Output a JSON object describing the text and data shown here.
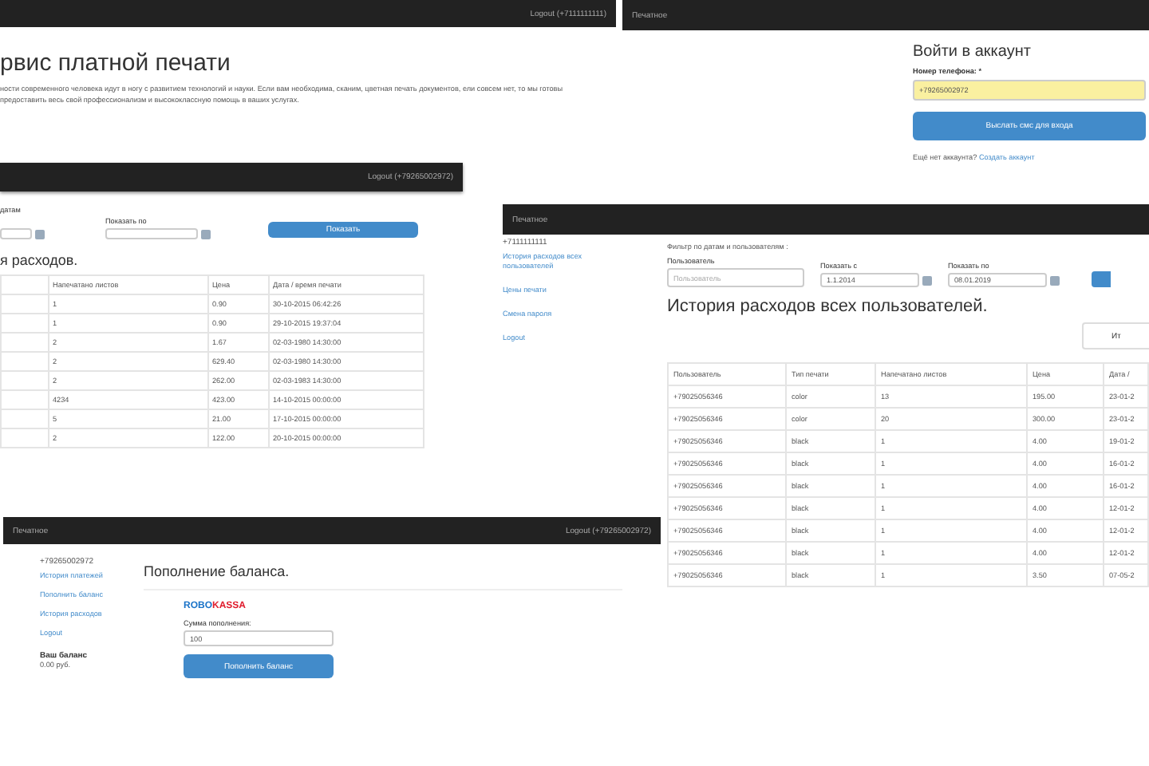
{
  "home_page": {
    "navbar": {
      "logout": "Logout (+7111111111)"
    },
    "heading": "рвис платной печати",
    "paragraph": "ности современного человека идут в ногу с развитием технологий и науки. Если вам необходима, сканим, цветная печать документов, ели совсем нет, то мы готовы предоставить весь свой профессионализм и высококлассную помощь в ваших услугах."
  },
  "login_page": {
    "navbar": {
      "brand": "Печатное"
    },
    "heading": "Войти в аккаунт",
    "phone_label": "Номер телефона: *",
    "phone_value": "+79265002972",
    "submit": "Выслать смс для входа",
    "signup_text": "Ещё нет аккаунта?",
    "signup_link": "Создать аккаунт"
  },
  "history_page": {
    "navbar": {
      "logout": "Logout (+79265002972)"
    },
    "filter_label": "датам",
    "to_label": "Показать по",
    "show_button": "Показать",
    "heading": "я расходов.",
    "table": {
      "columns": [
        "",
        "Напечатано листов",
        "Цена",
        "Дата / время печати"
      ],
      "rows": [
        [
          "",
          "1",
          "0.90",
          "30-10-2015 06:42:26"
        ],
        [
          "",
          "1",
          "0.90",
          "29-10-2015 19:37:04"
        ],
        [
          "",
          "2",
          "1.67",
          "02-03-1980 14:30:00"
        ],
        [
          "",
          "2",
          "629.40",
          "02-03-1980 14:30:00"
        ],
        [
          "",
          "2",
          "262.00",
          "02-03-1983 14:30:00"
        ],
        [
          "",
          "4234",
          "423.00",
          "14-10-2015 00:00:00"
        ],
        [
          "",
          "5",
          "21.00",
          "17-10-2015 00:00:00"
        ],
        [
          "",
          "2",
          "122.00",
          "20-10-2015 00:00:00"
        ]
      ]
    }
  },
  "admin_history_page": {
    "navbar": {
      "brand": "Печатное"
    },
    "sidebar": {
      "user": "+7111111111",
      "items": [
        {
          "label": "История расходов всех пользователей",
          "selected": false
        },
        {
          "label": "Цены печати",
          "selected": false
        },
        {
          "label": "Смена пароля",
          "selected": false
        },
        {
          "label": "Logout",
          "selected": false
        }
      ]
    },
    "filter_title": "Фильтр по датам и пользователям :",
    "user_label": "Пользователь",
    "user_placeholder": "Пользователь",
    "from_label": "Показать с",
    "from_value": "1.1.2014",
    "to_label": "Показать по",
    "to_value": "08.01.2019",
    "heading": "История расходов всех пользователей.",
    "total_button": "Ит",
    "table": {
      "columns": [
        "Пользователь",
        "Тип печати",
        "Напечатано листов",
        "Цена",
        "Дата /"
      ],
      "rows": [
        [
          "+79025056346",
          "color",
          "13",
          "195.00",
          "23-01-2"
        ],
        [
          "+79025056346",
          "color",
          "20",
          "300.00",
          "23-01-2"
        ],
        [
          "+79025056346",
          "black",
          "1",
          "4.00",
          "19-01-2"
        ],
        [
          "+79025056346",
          "black",
          "1",
          "4.00",
          "16-01-2"
        ],
        [
          "+79025056346",
          "black",
          "1",
          "4.00",
          "16-01-2"
        ],
        [
          "+79025056346",
          "black",
          "1",
          "4.00",
          "12-01-2"
        ],
        [
          "+79025056346",
          "black",
          "1",
          "4.00",
          "12-01-2"
        ],
        [
          "+79025056346",
          "black",
          "1",
          "4.00",
          "12-01-2"
        ],
        [
          "+79025056346",
          "black",
          "1",
          "3.50",
          "07-05-2"
        ]
      ]
    }
  },
  "topup_page": {
    "navbar": {
      "brand": "Печатное",
      "logout": "Logout (+79265002972)"
    },
    "sidebar": {
      "user": "+79265002972",
      "items": [
        {
          "label": "История платежей",
          "selected": false
        },
        {
          "label": "Пополнить баланс",
          "selected": false
        },
        {
          "label": "История расходов",
          "selected": false
        },
        {
          "label": "Logout",
          "selected": false
        }
      ],
      "balance_label": "Ваш баланс",
      "balance_value": "0.00 руб."
    },
    "heading": "Пополнение баланса.",
    "logo": {
      "part_1": "ROBO",
      "part_2": "KASSA"
    },
    "amount_label": "Сумма пополнения:",
    "amount_value": "100",
    "submit": "Пополнить баланс"
  }
}
